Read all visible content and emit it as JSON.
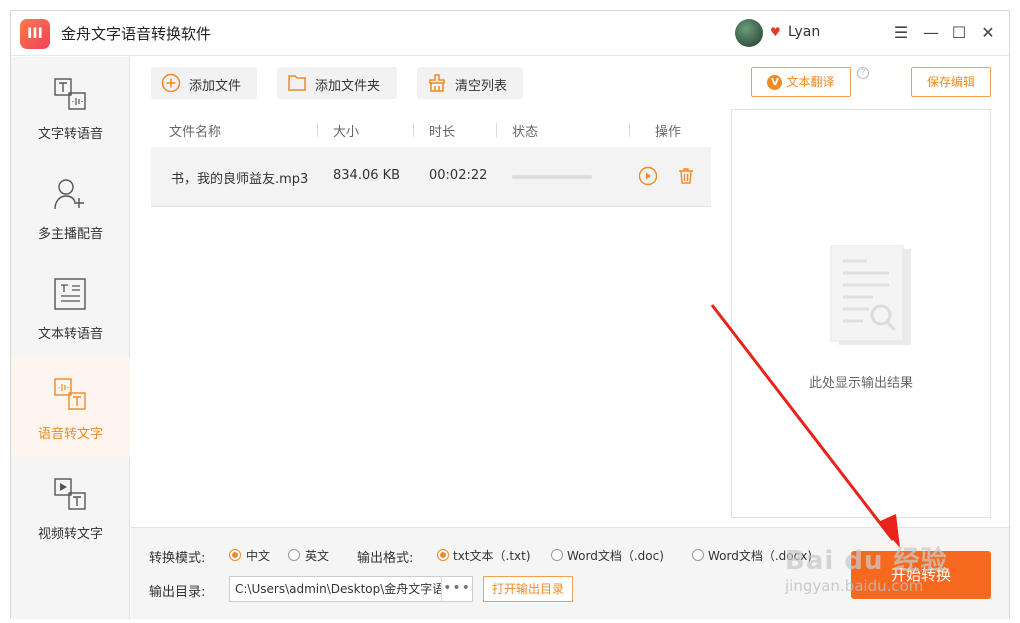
{
  "app": {
    "title": "金舟文字语音转换软件",
    "logo_text": "III"
  },
  "user": {
    "name": "Lyan"
  },
  "window_controls": {
    "menu": "☰",
    "minimize": "—",
    "maximize": "☐",
    "close": "✕"
  },
  "sidebar": {
    "items": [
      {
        "label": "文字转语音"
      },
      {
        "label": "多主播配音"
      },
      {
        "label": "文本转语音"
      },
      {
        "label": "语音转文字"
      },
      {
        "label": "视频转文字"
      }
    ]
  },
  "toolbar": {
    "add_file": "添加文件",
    "add_folder": "添加文件夹",
    "clear_list": "清空列表",
    "translate": "文本翻译",
    "translate_badge": "V",
    "help": "?",
    "save_edit": "保存编辑"
  },
  "table": {
    "headers": [
      "文件名称",
      "大小",
      "时长",
      "状态",
      "操作"
    ],
    "rows": [
      {
        "name": "书，我的良师益友.mp3",
        "size": "834.06 KB",
        "duration": "00:02:22",
        "progress": 0
      }
    ]
  },
  "output": {
    "hint": "此处显示输出结果"
  },
  "settings": {
    "mode_label": "转换模式:",
    "mode_options": [
      {
        "label": "中文",
        "selected": true
      },
      {
        "label": "英文",
        "selected": false
      }
    ],
    "format_label": "输出格式:",
    "format_options": [
      {
        "label": "txt文本（.txt)",
        "selected": true
      },
      {
        "label": "Word文档（.doc)",
        "selected": false
      },
      {
        "label": "Word文档（.docx)",
        "selected": false
      }
    ],
    "dir_label": "输出目录:",
    "dir_value": "C:\\Users\\admin\\Desktop\\金舟文字语音转换软件",
    "dir_more": "•••",
    "open_dir": "打开输出目录",
    "start": "开始转换"
  },
  "watermark": {
    "logo": "Bai du 经验",
    "url": "jingyan.baidu.com"
  },
  "colors": {
    "accent": "#f08a24",
    "start_button": "#f6691f",
    "arrow": "#e8231b"
  }
}
